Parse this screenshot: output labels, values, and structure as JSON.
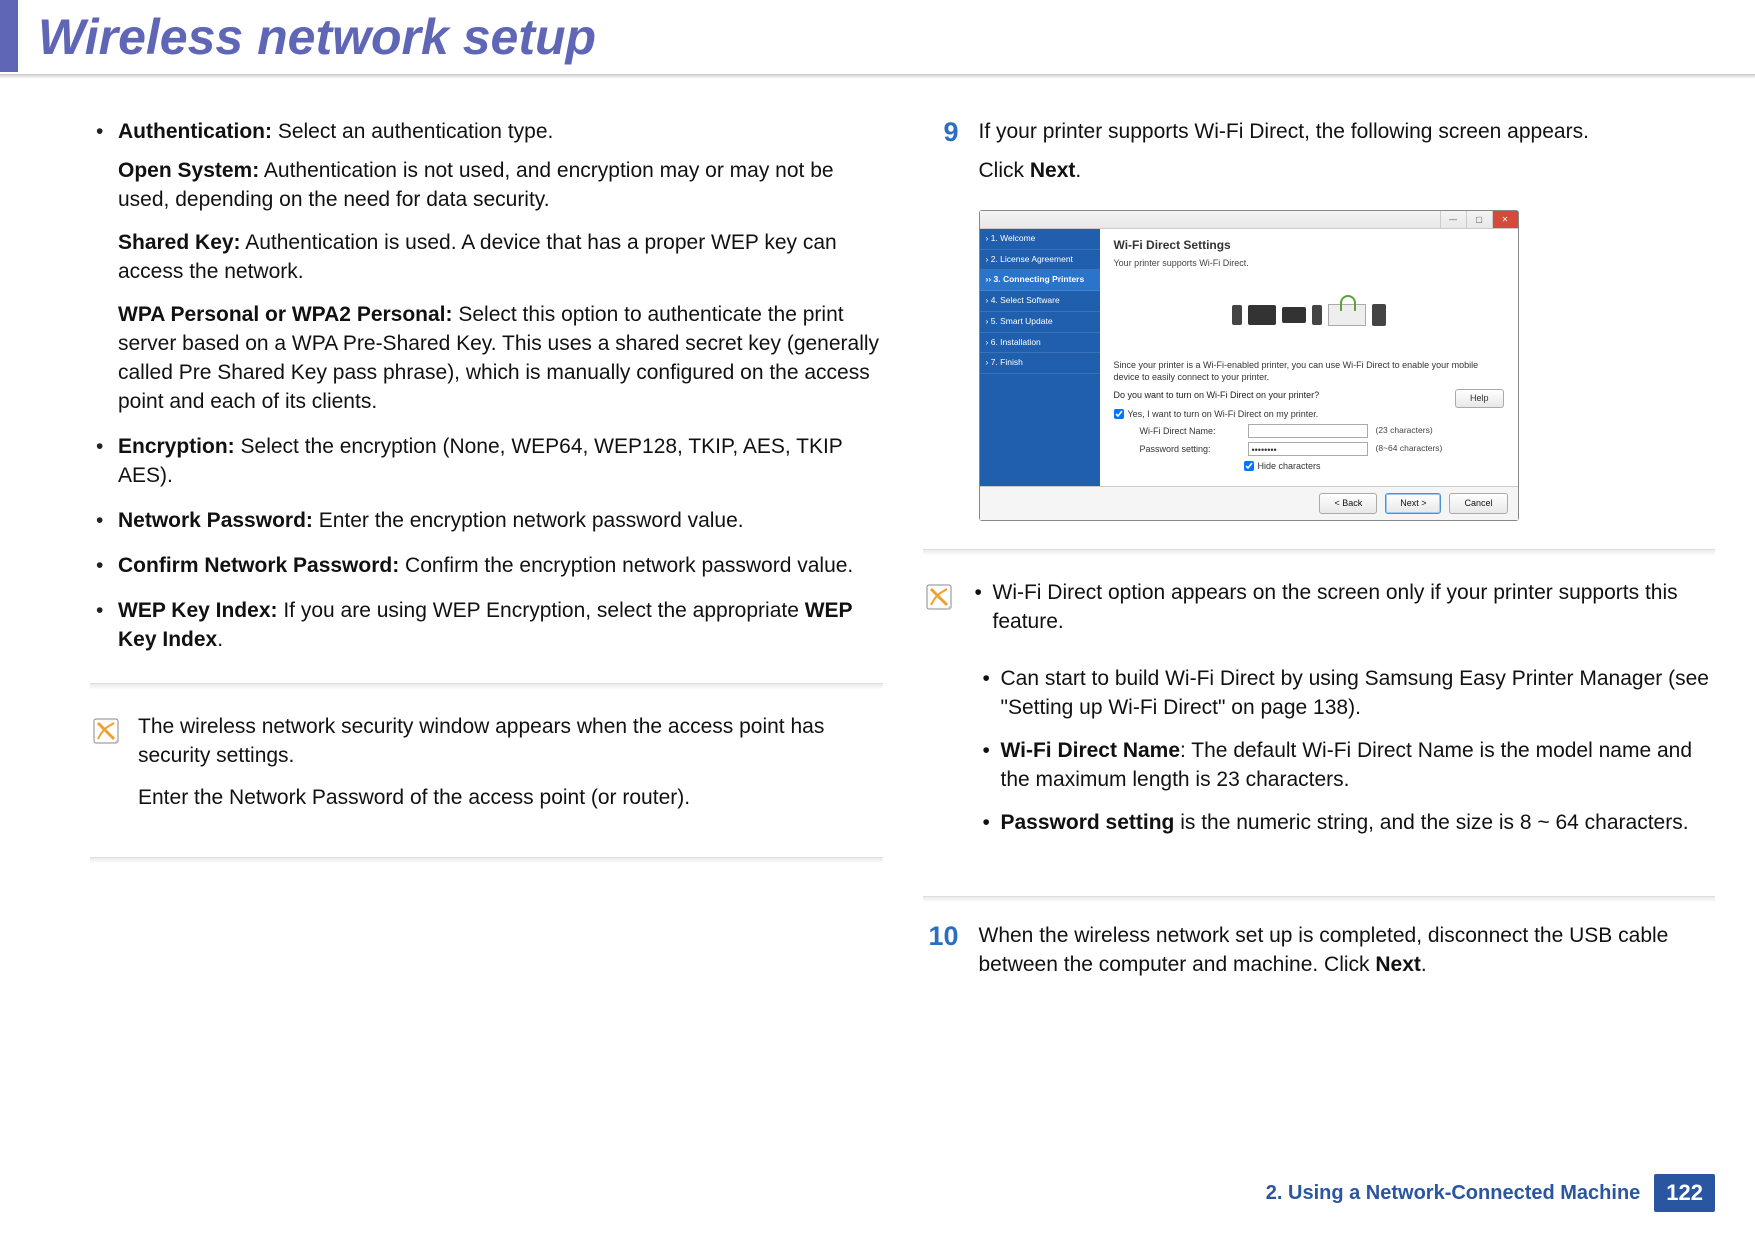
{
  "header": {
    "title": "Wireless network setup"
  },
  "left": {
    "items": [
      {
        "lead": "Authentication:",
        "text": " Select an authentication type.",
        "subs": [
          {
            "lead": "Open System:",
            "text": " Authentication is not used, and encryption may or may not be used, depending on the need for data security."
          },
          {
            "lead": "Shared Key:",
            "text": " Authentication is used. A device that has a proper WEP key can access the network."
          },
          {
            "lead": "WPA Personal or WPA2 Personal:",
            "text": " Select this option to authenticate the print server based on a WPA Pre-Shared Key. This uses a shared secret key (generally called Pre Shared Key pass phrase), which is manually configured on the access point and each of its clients."
          }
        ]
      },
      {
        "lead": "Encryption:",
        "text": " Select the encryption (None, WEP64, WEP128, TKIP, AES, TKIP AES)."
      },
      {
        "lead": "Network Password:",
        "text": " Enter the encryption network password value."
      },
      {
        "lead": "Confirm Network Password:",
        "text": " Confirm the encryption network password value."
      },
      {
        "lead": "WEP Key Index:",
        "text_a": " If you are using WEP Encryption, select the appropriate ",
        "text_bold": "WEP Key Index",
        "text_c": "."
      }
    ],
    "note": {
      "p1": "The wireless network security window appears when the access point has security settings.",
      "p2": "Enter the Network Password of the access point (or router)."
    }
  },
  "right": {
    "step9": {
      "num": "9",
      "p1": "If your printer supports Wi-Fi Direct, the following screen appears.",
      "p2_a": "Click ",
      "p2_b": "Next",
      "p2_c": "."
    },
    "installer": {
      "nav": [
        "› 1. Welcome",
        "› 2. License Agreement",
        "›› 3. Connecting Printers",
        "› 4. Select Software",
        "› 5. Smart Update",
        "› 6. Installation",
        "› 7. Finish"
      ],
      "title": "Wi-Fi Direct Settings",
      "sub": "Your printer supports Wi-Fi Direct.",
      "desc": "Since your printer is a Wi-Fi-enabled printer, you can use Wi-Fi Direct to enable your mobile device to easily connect to your printer.",
      "question": "Do you want to turn on Wi-Fi Direct on your printer?",
      "check_label": "Yes, I want to turn on Wi-Fi Direct on my printer.",
      "help": "Help",
      "field1_label": "Wi-Fi Direct Name:",
      "field1_hint": "(23 characters)",
      "field2_label": "Password setting:",
      "field2_value": "••••••••",
      "field2_hint": "(8~64 characters)",
      "hide": "Hide characters",
      "btn_back": "< Back",
      "btn_next": "Next >",
      "btn_cancel": "Cancel"
    },
    "note2": {
      "i1": "Wi-Fi Direct option appears on the screen only if your printer supports this feature.",
      "i2_a": "Can start to build Wi-Fi Direct by using ",
      "i2_b": "Samsung Easy Printer Manager (see ",
      "i2_c": "\"Setting up Wi-Fi Direct\" on page 138).",
      "i3_lead": "Wi-Fi Direct Name",
      "i3_text": ": The default Wi-Fi Direct Name is the model name and the maximum length is 23 characters.",
      "i4_lead": "Password setting",
      "i4_text": " is the numeric string, and the size is 8 ~ 64 characters."
    },
    "step10": {
      "num": "10",
      "text_a": "When the wireless network set up is completed, disconnect the USB cable between the computer and machine. Click ",
      "text_b": "Next",
      "text_c": "."
    }
  },
  "footer": {
    "text": "2.  Using a Network-Connected Machine",
    "page": "122"
  }
}
